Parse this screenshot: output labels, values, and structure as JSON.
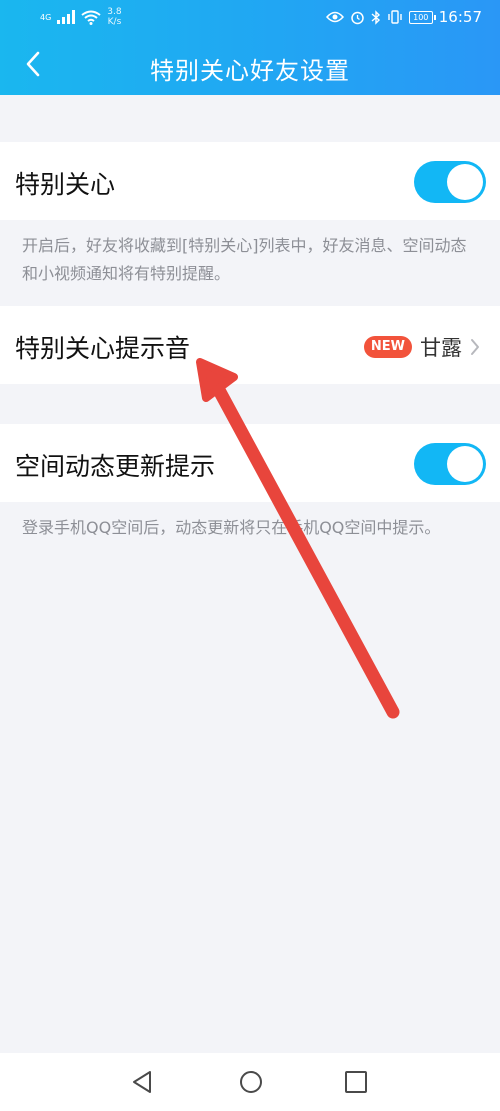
{
  "status_bar": {
    "network": "4G",
    "speed_value": "3.8",
    "speed_unit": "K/s",
    "battery": "100",
    "time": "16:57"
  },
  "header": {
    "title": "特别关心好友设置",
    "back_icon": "chevron-left-icon"
  },
  "settings": {
    "special_care": {
      "label": "特别关心",
      "enabled": true,
      "description": "开启后，好友将收藏到[特别关心]列表中，好友消息、空间动态和小视频通知将有特别提醒。"
    },
    "ringtone": {
      "label": "特别关心提示音",
      "badge": "NEW",
      "value": "甘露"
    },
    "qzone_update": {
      "label": "空间动态更新提示",
      "enabled": true,
      "description": "登录手机QQ空间后，动态更新将只在手机QQ空间中提示。"
    }
  },
  "colors": {
    "accent": "#12b7f5",
    "badge": "#f2533b",
    "annotation_arrow": "#e8453c"
  },
  "system_nav": [
    "back-triangle-icon",
    "home-circle-icon",
    "recents-square-icon"
  ]
}
